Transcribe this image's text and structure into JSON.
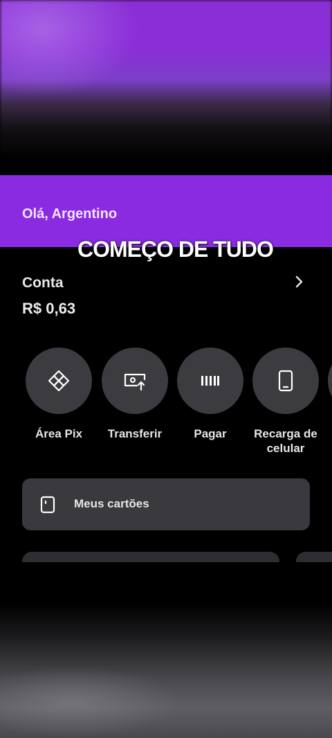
{
  "header": {
    "greeting": "Olá, Argentino",
    "color": "#8a2be2"
  },
  "overlay": {
    "caption": "COMEÇO DE TUDO"
  },
  "account": {
    "label": "Conta",
    "balance": "R$ 0,63",
    "chevron_icon": "chevron-right-icon"
  },
  "actions": [
    {
      "label": "Área Pix",
      "icon": "pix-icon"
    },
    {
      "label": "Transferir",
      "icon": "transfer-icon"
    },
    {
      "label": "Pagar",
      "icon": "barcode-icon"
    },
    {
      "label": "Recarga de celular",
      "icon": "phone-icon"
    }
  ],
  "cards": {
    "label": "Meus cartões",
    "icon": "card-icon"
  }
}
